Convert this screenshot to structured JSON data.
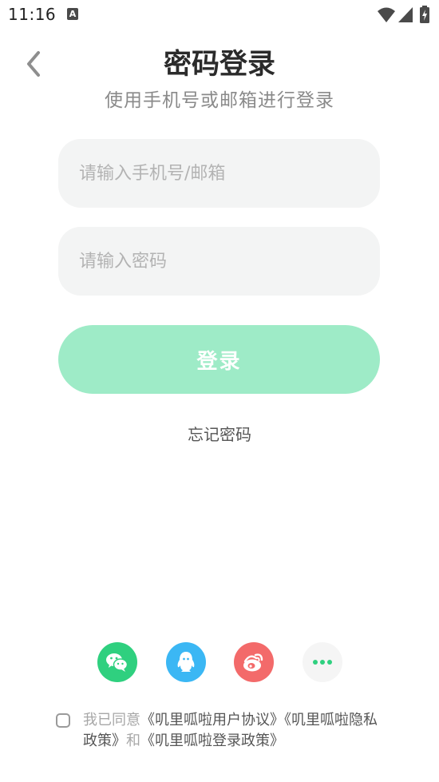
{
  "status_bar": {
    "time": "11:16",
    "notification_icon": "a-letter-icon",
    "icons": [
      "wifi-icon",
      "signal-icon",
      "battery-charging-icon"
    ]
  },
  "header": {
    "back_icon": "chevron-left-icon",
    "title": "密码登录",
    "subtitle": "使用手机号或邮箱进行登录"
  },
  "form": {
    "phone_placeholder": "请输入手机号/邮箱",
    "phone_value": "",
    "password_placeholder": "请输入密码",
    "password_value": "",
    "login_label": "登录",
    "forgot_label": "忘记密码"
  },
  "social": {
    "items": [
      {
        "name": "wechat",
        "icon": "wechat-icon",
        "color": "#2fd07f"
      },
      {
        "name": "qq",
        "icon": "qq-icon",
        "color": "#3bb7f4"
      },
      {
        "name": "weibo",
        "icon": "weibo-icon",
        "color": "#f36a6a"
      },
      {
        "name": "more",
        "icon": "more-dots-icon",
        "color": "#f5f5f5"
      }
    ]
  },
  "agreement": {
    "checked": false,
    "prefix": "我已同意",
    "user_agreement": "《叽里呱啦用户协议》",
    "privacy_policy": "《叽里呱啦隐私政策》",
    "joiner": "和",
    "login_policy": "《叽里呱啦登录政策》"
  },
  "colors": {
    "accent": "#2fd07f",
    "login_button": "#9eebc7",
    "input_bg": "#f3f4f4"
  }
}
